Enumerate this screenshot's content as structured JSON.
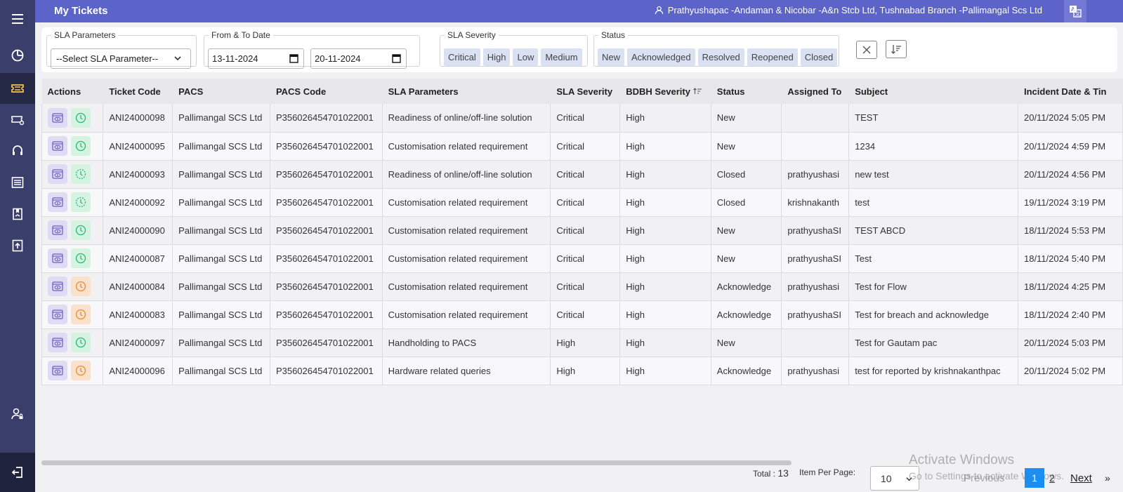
{
  "header": {
    "title": "My Tickets",
    "user": "Prathyushapac -Andaman & Nicobar -A&n Stcb Ltd, Tushnabad Branch -Pallimangal Scs Ltd"
  },
  "sidebar": {
    "items": [
      {
        "icon": "menu-icon"
      },
      {
        "icon": "dashboard-icon"
      },
      {
        "icon": "ticket-icon"
      },
      {
        "icon": "ticket-settings-icon"
      },
      {
        "icon": "headset-icon"
      },
      {
        "icon": "list-icon"
      },
      {
        "icon": "report-icon"
      },
      {
        "icon": "upload-icon"
      },
      {
        "icon": "user-lock-icon"
      },
      {
        "icon": "logout-icon"
      }
    ]
  },
  "filters": {
    "sla_parameters": {
      "label": "SLA Parameters",
      "value": "--Select SLA Parameter--"
    },
    "date_range": {
      "label": "From & To Date",
      "from": "13-11-2024",
      "to": "20-11-2024"
    },
    "sla_severity": {
      "label": "SLA Severity",
      "options": [
        "Critical",
        "High",
        "Low",
        "Medium"
      ]
    },
    "status": {
      "label": "Status",
      "options": [
        "New",
        "Acknowledged",
        "Resolved",
        "Reopened",
        "Closed"
      ]
    }
  },
  "table": {
    "columns": [
      "Actions",
      "Ticket Code",
      "PACS",
      "PACS Code",
      "SLA Parameters",
      "SLA Severity",
      "BDBH Severity",
      "Status",
      "Assigned To",
      "Subject",
      "Incident Date & Tin"
    ],
    "rows": [
      {
        "clock": "green",
        "cells": [
          "ANI24000098",
          "Pallimangal SCS Ltd",
          "P356026454701022001",
          "Readiness of online/off-line solution",
          "Critical",
          "High",
          "New",
          "",
          "TEST",
          "20/11/2024 5:05 PM"
        ]
      },
      {
        "clock": "green",
        "cells": [
          "ANI24000095",
          "Pallimangal SCS Ltd",
          "P356026454701022001",
          "Customisation related requirement",
          "Critical",
          "High",
          "New",
          "",
          "1234",
          "20/11/2024 4:59 PM"
        ]
      },
      {
        "clock": "green-dashed",
        "cells": [
          "ANI24000093",
          "Pallimangal SCS Ltd",
          "P356026454701022001",
          "Readiness of online/off-line solution",
          "Critical",
          "High",
          "Closed",
          "prathyushasi",
          "new test",
          "20/11/2024 4:56 PM"
        ]
      },
      {
        "clock": "green-dashed",
        "cells": [
          "ANI24000092",
          "Pallimangal SCS Ltd",
          "P356026454701022001",
          "Customisation related requirement",
          "Critical",
          "High",
          "Closed",
          "krishnakanth",
          "test",
          "19/11/2024 3:19 PM"
        ]
      },
      {
        "clock": "green",
        "cells": [
          "ANI24000090",
          "Pallimangal SCS Ltd",
          "P356026454701022001",
          "Customisation related requirement",
          "Critical",
          "High",
          "New",
          "prathyushaSI",
          "TEST ABCD",
          "18/11/2024 5:53 PM"
        ]
      },
      {
        "clock": "green",
        "cells": [
          "ANI24000087",
          "Pallimangal SCS Ltd",
          "P356026454701022001",
          "Customisation related requirement",
          "Critical",
          "High",
          "New",
          "prathyushaSI",
          "Test",
          "18/11/2024 5:40 PM"
        ]
      },
      {
        "clock": "orange",
        "cells": [
          "ANI24000084",
          "Pallimangal SCS Ltd",
          "P356026454701022001",
          "Customisation related requirement",
          "Critical",
          "High",
          "Acknowledge",
          "prathyushasi",
          "Test for Flow",
          "18/11/2024 4:25 PM"
        ]
      },
      {
        "clock": "orange",
        "cells": [
          "ANI24000083",
          "Pallimangal SCS Ltd",
          "P356026454701022001",
          "Customisation related requirement",
          "Critical",
          "High",
          "Acknowledge",
          "prathyushaSI",
          "Test for breach and acknowledge",
          "18/11/2024 2:40 PM"
        ]
      },
      {
        "clock": "green",
        "cells": [
          "ANI24000097",
          "Pallimangal SCS Ltd",
          "P356026454701022001",
          "Handholding to PACS",
          "High",
          "High",
          "New",
          "",
          "Test for Gautam pac",
          "20/11/2024 5:03 PM"
        ]
      },
      {
        "clock": "orange",
        "cells": [
          "ANI24000096",
          "Pallimangal SCS Ltd",
          "P356026454701022001",
          "Hardware related queries",
          "High",
          "High",
          "Acknowledge",
          "prathyushasi",
          "test for reported by krishnakanthpac",
          "20/11/2024 5:02 PM"
        ]
      }
    ]
  },
  "pagination": {
    "total_label": "Total :",
    "total": "13",
    "per_page_label": "Item Per Page:",
    "per_page": "10",
    "previous": "Previous",
    "pages": [
      "1",
      "2"
    ],
    "next": "Next",
    "next_arrow": "»"
  },
  "watermark": {
    "line1": "Activate Windows",
    "line2": "Go to Settings to activate Windows."
  },
  "colors": {
    "sidebar": "#3a3e6b",
    "topbar": "#5c63c9",
    "accent": "#1d8ef0"
  }
}
